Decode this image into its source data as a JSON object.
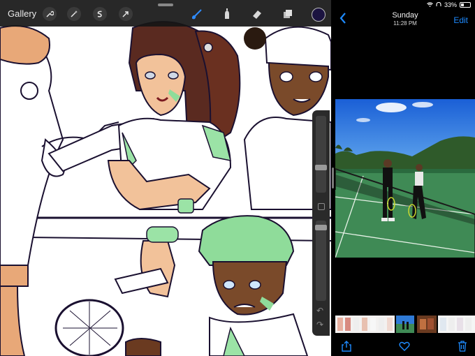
{
  "procreate": {
    "gallery_label": "Gallery",
    "tools": [
      "wrench-icon",
      "magic-wand-icon",
      "selection-icon",
      "transform-arrow-icon"
    ],
    "right_tools": [
      "brush-icon",
      "smudge-icon",
      "eraser-icon",
      "layers-icon"
    ],
    "current_color": "#1b1340",
    "accent": "#2f8cff"
  },
  "photos": {
    "status": {
      "battery": "33%"
    },
    "header": {
      "day": "Sunday",
      "time": "11:28 PM",
      "edit_label": "Edit"
    },
    "toolbar": [
      "share-icon",
      "favorite-heart-icon",
      "trash-icon"
    ],
    "accent": "#1e8bff"
  }
}
